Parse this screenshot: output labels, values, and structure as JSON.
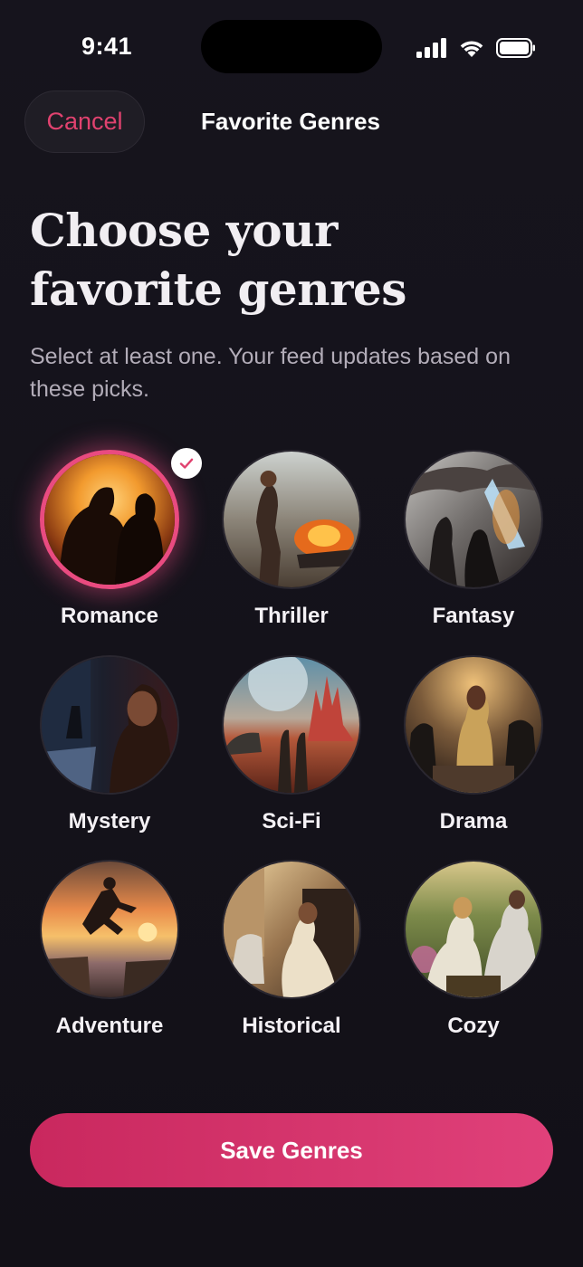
{
  "status_bar": {
    "time": "9:41"
  },
  "nav": {
    "cancel_label": "Cancel",
    "title": "Favorite Genres"
  },
  "header": {
    "title_line1": "Choose your",
    "title_line2": "favorite genres",
    "subtitle": "Select at least one. Your feed updates based on these picks."
  },
  "genres": [
    {
      "label": "Romance",
      "selected": true
    },
    {
      "label": "Thriller",
      "selected": false
    },
    {
      "label": "Fantasy",
      "selected": false
    },
    {
      "label": "Mystery",
      "selected": false
    },
    {
      "label": "Sci-Fi",
      "selected": false
    },
    {
      "label": "Drama",
      "selected": false
    },
    {
      "label": "Adventure",
      "selected": false
    },
    {
      "label": "Historical",
      "selected": false
    },
    {
      "label": "Cozy",
      "selected": false
    }
  ],
  "footer": {
    "save_label": "Save Genres"
  },
  "colors": {
    "accent": "#e0426f",
    "background": "#16141d"
  }
}
